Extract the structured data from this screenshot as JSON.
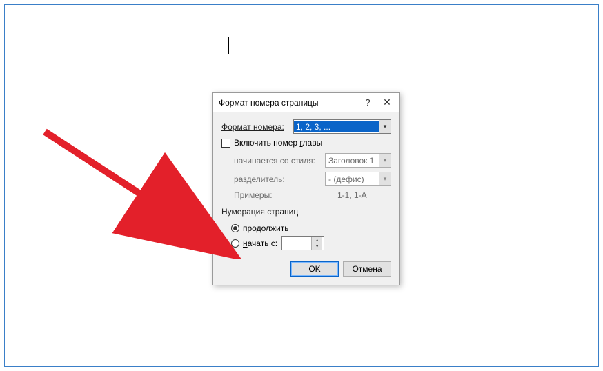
{
  "dialog": {
    "title": "Формат номера страницы",
    "help_symbol": "?",
    "close_symbol": "✕",
    "format_label": "Формат номера:",
    "format_value": "1, 2, 3, ...",
    "include_chapter_label": "Включить номер главы",
    "chapter_style_label": "начинается со стиля:",
    "chapter_style_value": "Заголовок 1",
    "separator_label": "разделитель:",
    "separator_value": "-   (дефис)",
    "examples_label": "Примеры:",
    "examples_value": "1-1, 1-A",
    "numbering_legend": "Нумерация страниц",
    "continue_label": "продолжить",
    "start_at_label": "начать с:",
    "start_at_value": "",
    "ok_label": "OK",
    "cancel_label": "Отмена"
  }
}
